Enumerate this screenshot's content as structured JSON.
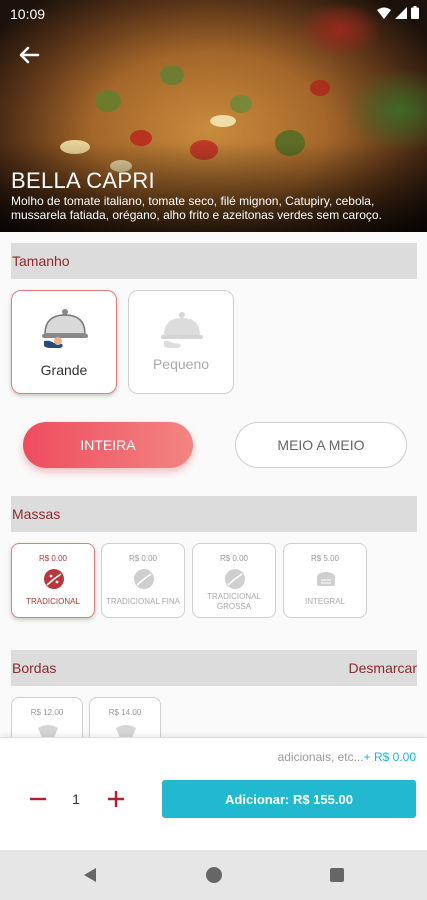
{
  "status_bar": {
    "time": "10:09"
  },
  "product": {
    "title": "BELLA CAPRI",
    "description": "Molho de tomate italiano, tomate seco, filé mignon, Catupiry, cebola, mussarela fatiada, orégano, alho frito e azeitonas verdes sem caroço."
  },
  "size_section": {
    "header": "Tamanho",
    "options": [
      {
        "label": "Grande",
        "selected": true,
        "icon": "serving-cloche-icon"
      },
      {
        "label": "Pequeno",
        "selected": false,
        "icon": "serving-cloche-icon"
      }
    ]
  },
  "split_options": [
    {
      "label": "INTEIRA",
      "selected": true
    },
    {
      "label": "MEIO A MEIO",
      "selected": false
    }
  ],
  "massas_section": {
    "header": "Massas",
    "options": [
      {
        "price": "R$ 0.00",
        "name": "TRADICIONAL",
        "selected": true,
        "icon": "pizza-slice-icon"
      },
      {
        "price": "R$ 0.00",
        "name": "TRADICIONAL FINA",
        "selected": false,
        "icon": "pizza-slice-icon"
      },
      {
        "price": "R$ 0.00",
        "name": "TRADICIONAL GROSSA",
        "selected": false,
        "icon": "pizza-slice-icon"
      },
      {
        "price": "R$ 5.00",
        "name": "INTEGRAL",
        "selected": false,
        "icon": "bread-icon"
      }
    ]
  },
  "bordas_section": {
    "header": "Bordas",
    "clear_label": "Desmarcar",
    "options": [
      {
        "price": "R$ 12.00",
        "icon": "crust-icon"
      },
      {
        "price": "R$ 14.00",
        "icon": "crust-icon"
      }
    ]
  },
  "cart_bar": {
    "extras_text": "adicionais, etc...",
    "extras_amount": "+ R$ 0.00",
    "quantity": "1",
    "add_button": "Adicionar: R$ 155.00"
  },
  "colors": {
    "accent_red": "#ef4c5e",
    "accent_cyan": "#22b8cf",
    "header_text": "#8b2b2b"
  }
}
